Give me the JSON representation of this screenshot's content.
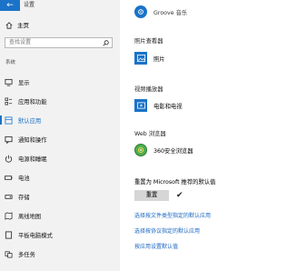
{
  "window": {
    "title": "设置",
    "back_glyph": "←"
  },
  "sidebar": {
    "home_label": "主页",
    "search_placeholder": "查找设置",
    "section_label": "系统",
    "items": [
      {
        "label": "显示",
        "icon": "monitor-icon"
      },
      {
        "label": "应用和功能",
        "icon": "apps-list-icon"
      },
      {
        "label": "默认应用",
        "icon": "default-apps-icon",
        "active": true
      },
      {
        "label": "通知和操作",
        "icon": "notification-icon"
      },
      {
        "label": "电源和睡眠",
        "icon": "power-icon"
      },
      {
        "label": "电池",
        "icon": "battery-icon"
      },
      {
        "label": "存储",
        "icon": "storage-icon"
      },
      {
        "label": "离线地图",
        "icon": "map-icon"
      },
      {
        "label": "平板电脑模式",
        "icon": "tablet-icon"
      },
      {
        "label": "多任务",
        "icon": "multitask-icon"
      }
    ]
  },
  "main": {
    "music_player": {
      "app": "Groove 音乐"
    },
    "photo_viewer": {
      "category": "照片查看器",
      "app": "照片"
    },
    "video_player": {
      "category": "视频播放器",
      "app": "电影和电视"
    },
    "web_browser": {
      "category": "Web 浏览器",
      "app": "360安全浏览器"
    },
    "reset": {
      "title": "重置为 Microsoft 推荐的默认值",
      "button": "重置",
      "check": "✔"
    },
    "links": [
      "选择按文件类型指定的默认应用",
      "选择按协议指定的默认应用",
      "按应用设置默认值"
    ]
  },
  "colors": {
    "accent": "#1a73c8",
    "sidebar_bg": "#f2f2f2"
  }
}
